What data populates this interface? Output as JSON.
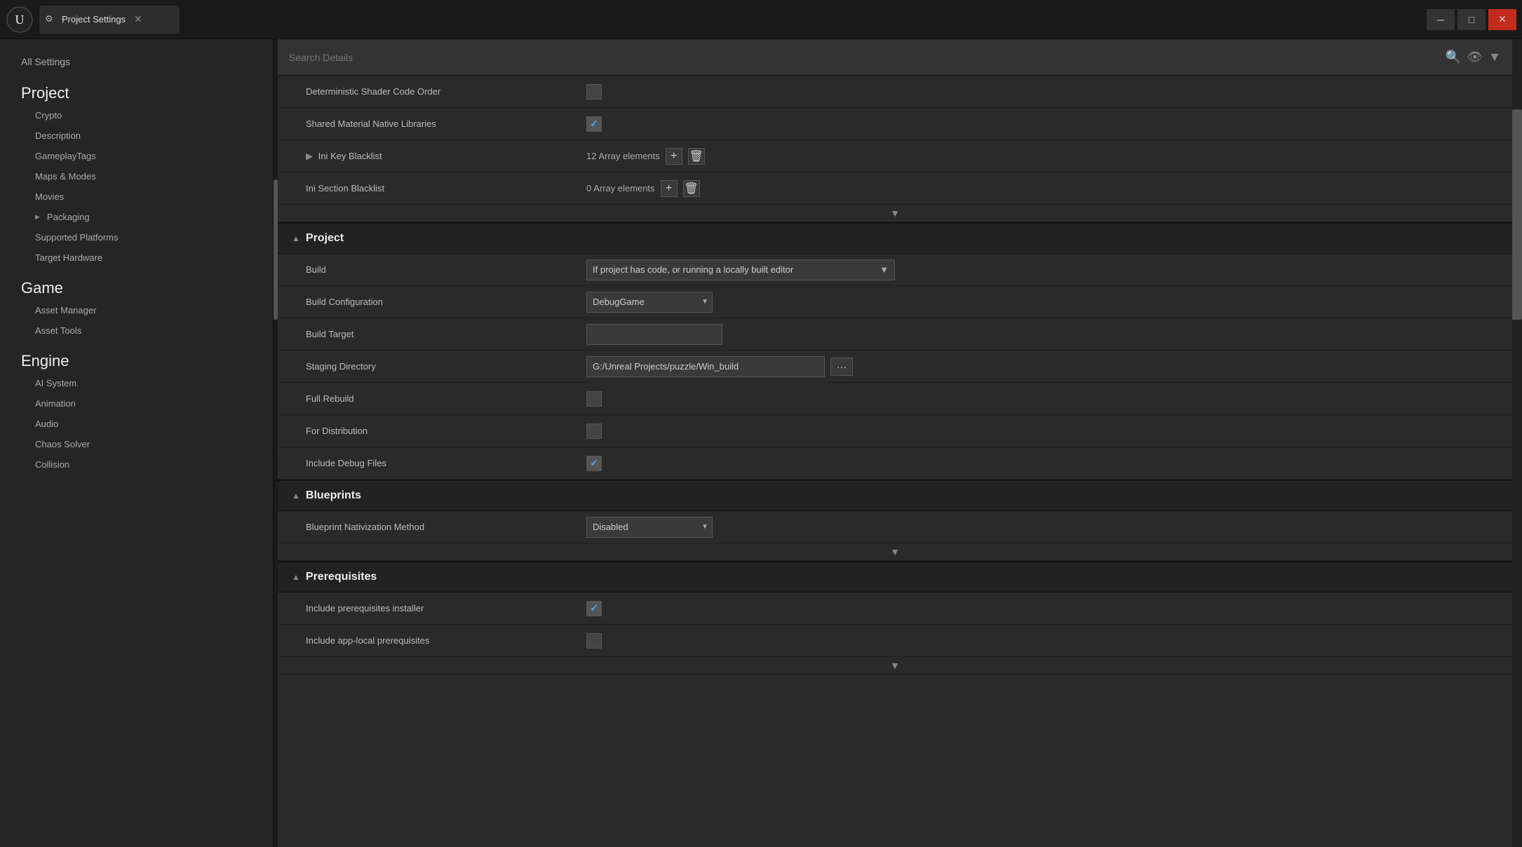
{
  "window": {
    "title": "Project Settings",
    "tab_icon": "⚙",
    "close": "✕",
    "minimize": "─",
    "maximize": "□"
  },
  "search": {
    "placeholder": "Search Details",
    "search_icon": "🔍",
    "eye_icon": "👁"
  },
  "sidebar": {
    "all_settings": "All Settings",
    "categories": [
      {
        "name": "Project",
        "items": [
          {
            "label": "Crypto",
            "arrow": false
          },
          {
            "label": "Description",
            "arrow": false
          },
          {
            "label": "GameplayTags",
            "arrow": false
          },
          {
            "label": "Maps & Modes",
            "arrow": false
          },
          {
            "label": "Movies",
            "arrow": false
          },
          {
            "label": "Packaging",
            "arrow": true
          },
          {
            "label": "Supported Platforms",
            "arrow": false
          },
          {
            "label": "Target Hardware",
            "arrow": false
          }
        ]
      },
      {
        "name": "Game",
        "items": [
          {
            "label": "Asset Manager",
            "arrow": false
          },
          {
            "label": "Asset Tools",
            "arrow": false
          }
        ]
      },
      {
        "name": "Engine",
        "items": [
          {
            "label": "AI System",
            "arrow": false
          },
          {
            "label": "Animation",
            "arrow": false
          },
          {
            "label": "Audio",
            "arrow": false
          },
          {
            "label": "Chaos Solver",
            "arrow": false
          },
          {
            "label": "Collision",
            "arrow": false
          }
        ]
      }
    ]
  },
  "content": {
    "top_rows": [
      {
        "label": "Deterministic Shader Code Order",
        "type": "checkbox",
        "checked": false
      },
      {
        "label": "Shared Material Native Libraries",
        "type": "checkbox",
        "checked": true
      },
      {
        "label": "Ini Key Blacklist",
        "type": "array",
        "count": "12 Array elements",
        "has_arrow": true
      },
      {
        "label": "Ini Section Blacklist",
        "type": "array",
        "count": "0 Array elements",
        "has_arrow": false
      }
    ],
    "sections": [
      {
        "title": "Project",
        "rows": [
          {
            "label": "Build",
            "type": "dropdown_long",
            "value": "If project has code, or running a locally built editor"
          },
          {
            "label": "Build Configuration",
            "type": "dropdown",
            "value": "DebugGame"
          },
          {
            "label": "Build Target",
            "type": "input",
            "value": ""
          },
          {
            "label": "Staging Directory",
            "type": "input_path",
            "value": "G:/Unreal Projects/puzzle/Win_build"
          },
          {
            "label": "Full Rebuild",
            "type": "checkbox",
            "checked": false
          },
          {
            "label": "For Distribution",
            "type": "checkbox",
            "checked": false
          },
          {
            "label": "Include Debug Files",
            "type": "checkbox",
            "checked": true
          }
        ]
      },
      {
        "title": "Blueprints",
        "rows": [
          {
            "label": "Blueprint Nativization Method",
            "type": "dropdown",
            "value": "Disabled"
          }
        ]
      },
      {
        "title": "Prerequisites",
        "rows": [
          {
            "label": "Include prerequisites installer",
            "type": "checkbox",
            "checked": true
          },
          {
            "label": "Include app-local prerequisites",
            "type": "checkbox",
            "checked": false
          }
        ]
      }
    ]
  }
}
